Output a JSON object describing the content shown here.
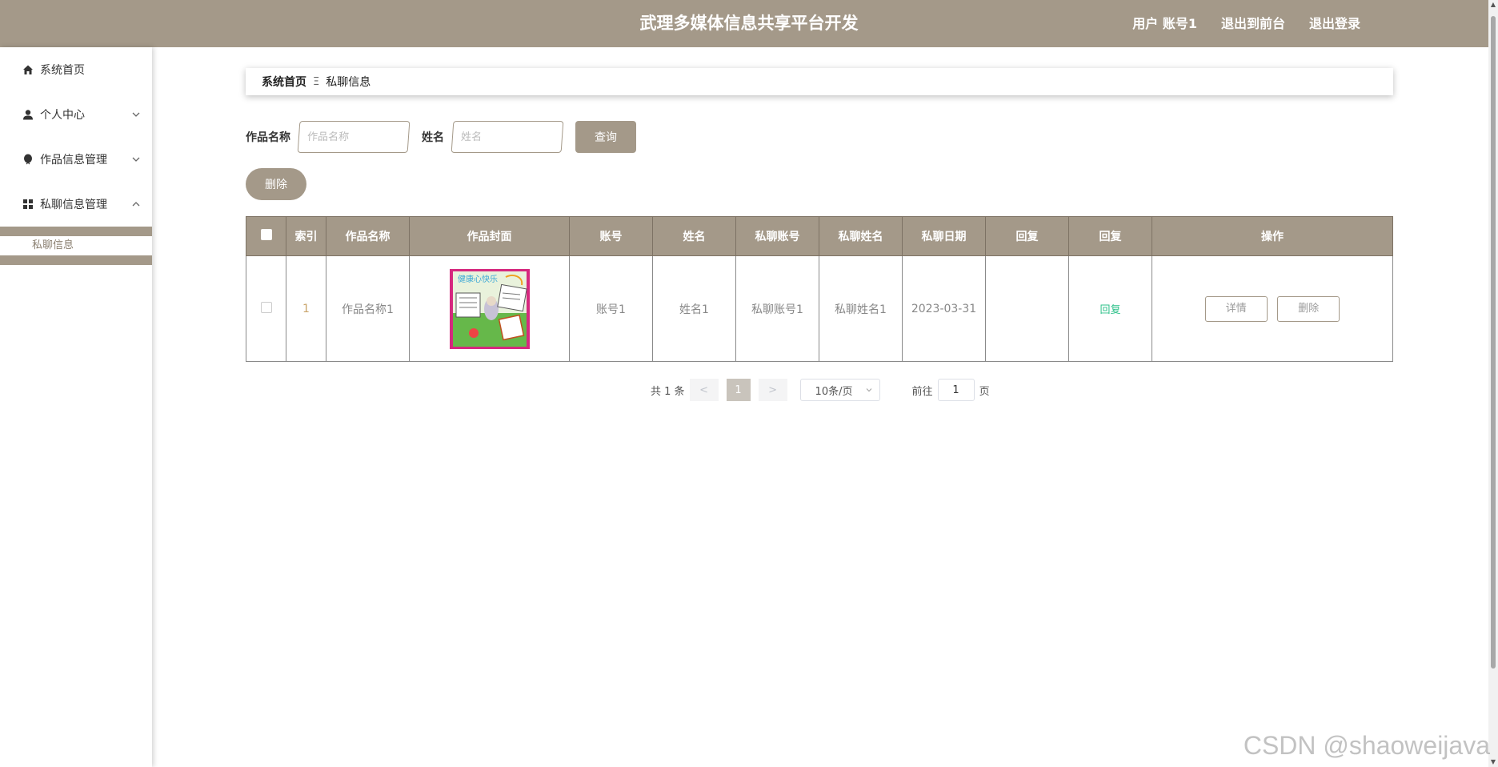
{
  "header": {
    "title": "武理多媒体信息共享平台开发",
    "user_label": "用户 账号1",
    "to_front_label": "退出到前台",
    "logout_label": "退出登录"
  },
  "sidebar": {
    "items": [
      {
        "label": "系统首页",
        "icon": "home-icon"
      },
      {
        "label": "个人中心",
        "icon": "user-icon"
      },
      {
        "label": "作品信息管理",
        "icon": "balloon-icon"
      },
      {
        "label": "私聊信息管理",
        "icon": "grid-icon"
      }
    ],
    "submenu": {
      "label": "私聊信息"
    }
  },
  "breadcrumb": {
    "home": "系统首页",
    "separator": "Ξ",
    "current": "私聊信息"
  },
  "search": {
    "work_label": "作品名称",
    "work_placeholder": "作品名称",
    "name_label": "姓名",
    "name_placeholder": "姓名",
    "search_button": "查询"
  },
  "actions": {
    "delete_button": "删除"
  },
  "table": {
    "headers": [
      "索引",
      "作品名称",
      "作品封面",
      "账号",
      "姓名",
      "私聊账号",
      "私聊姓名",
      "私聊日期",
      "回复",
      "回复",
      "操作"
    ],
    "rows": [
      {
        "index": "1",
        "work_name": "作品名称1",
        "account": "账号1",
        "name": "姓名1",
        "chat_account": "私聊账号1",
        "chat_name": "私聊姓名1",
        "chat_date": "2023-03-31",
        "reply_text": "",
        "reply_link": "回复",
        "detail_button": "详情",
        "delete_button": "删除"
      }
    ]
  },
  "pagination": {
    "total": "共 1 条",
    "prev": "<",
    "current_page": "1",
    "next": ">",
    "page_size": "10条/页",
    "goto_label": "前往",
    "goto_value": "1",
    "page_suffix": "页"
  },
  "watermark": "CSDN @shaoweijava",
  "colors": {
    "accent": "#a49989",
    "reply_link": "#2ec18a",
    "index": "#c9a46a"
  }
}
